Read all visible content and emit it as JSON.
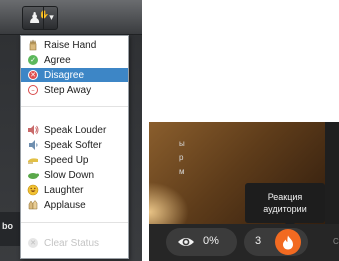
{
  "status_menu": {
    "items": [
      {
        "label": "Raise Hand",
        "icon": "raise-hand-icon",
        "selected": false,
        "disabled": false
      },
      {
        "label": "Agree",
        "icon": "agree-icon",
        "selected": false,
        "disabled": false
      },
      {
        "label": "Disagree",
        "icon": "disagree-icon",
        "selected": true,
        "disabled": false
      },
      {
        "label": "Step Away",
        "icon": "step-away-icon",
        "selected": false,
        "disabled": false
      },
      {
        "label": "Speak Louder",
        "icon": "speak-louder-icon",
        "selected": false,
        "disabled": false
      },
      {
        "label": "Speak Softer",
        "icon": "speak-softer-icon",
        "selected": false,
        "disabled": false
      },
      {
        "label": "Speed Up",
        "icon": "speed-up-icon",
        "selected": false,
        "disabled": false
      },
      {
        "label": "Slow Down",
        "icon": "slow-down-icon",
        "selected": false,
        "disabled": false
      },
      {
        "label": "Laughter",
        "icon": "laughter-icon",
        "selected": false,
        "disabled": false
      },
      {
        "label": "Applause",
        "icon": "applause-icon",
        "selected": false,
        "disabled": false
      },
      {
        "label": "Clear Status",
        "icon": "clear-status-icon",
        "selected": false,
        "disabled": true
      }
    ]
  },
  "sidebar_fragment": "bo",
  "meeting_bar": {
    "views_percent": "0%",
    "reaction_count": "3",
    "tooltip_line1": "Реакция",
    "tooltip_line2": "аудитории",
    "edge_fragment": "C"
  },
  "colors": {
    "selected_highlight": "#3d86c6",
    "fire_button": "#f26a21",
    "meeting_bar": "#262626",
    "toolbar": "#3a3c3f"
  }
}
